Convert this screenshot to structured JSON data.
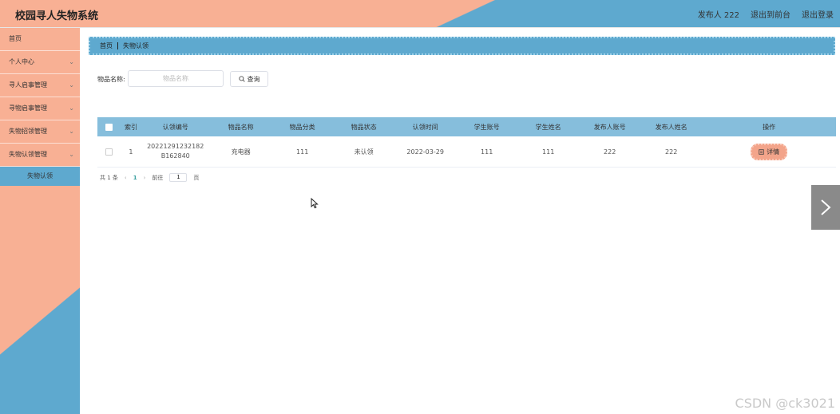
{
  "header": {
    "title": "校园寻人失物系统",
    "actions": [
      "发布人 222",
      "退出到前台",
      "退出登录"
    ]
  },
  "sidebar": {
    "items": [
      {
        "label": "首页",
        "has_arrow": false
      },
      {
        "label": "个人中心",
        "has_arrow": true
      },
      {
        "label": "寻人启事管理",
        "has_arrow": true
      },
      {
        "label": "寻物启事管理",
        "has_arrow": true
      },
      {
        "label": "失物招领管理",
        "has_arrow": true
      },
      {
        "label": "失物认领管理",
        "has_arrow": true
      }
    ],
    "active_sub": "失物认领"
  },
  "breadcrumb": [
    "首页",
    "失物认领"
  ],
  "search": {
    "label": "物品名称:",
    "placeholder": "物品名称",
    "button": "查询"
  },
  "table": {
    "headers": [
      "索引",
      "认领编号",
      "物品名称",
      "物品分类",
      "物品状态",
      "认领时间",
      "学生账号",
      "学生姓名",
      "发布人账号",
      "发布人姓名",
      "操作"
    ],
    "rows": [
      {
        "index": "1",
        "claim_no_1": "20221291232182",
        "claim_no_2": "B162840",
        "item_name": "充电器",
        "category": "111",
        "status": "未认领",
        "claim_time": "2022-03-29",
        "student_account": "111",
        "student_name": "111",
        "publisher_account": "222",
        "publisher_name": "222",
        "action": "详情"
      }
    ]
  },
  "pagination": {
    "total": "共 1 条",
    "current": "1",
    "goto_label": "前往",
    "goto_value": "1",
    "page_suffix": "页"
  },
  "watermark": "CSDN @ck3021",
  "colors": {
    "peach": "#f8b094",
    "blue": "#5ea9cf",
    "table_header": "#86bedc"
  },
  "icons": [
    "search-icon",
    "chevron-down-icon",
    "document-icon",
    "chevron-right-icon",
    "mouse-cursor-icon"
  ]
}
